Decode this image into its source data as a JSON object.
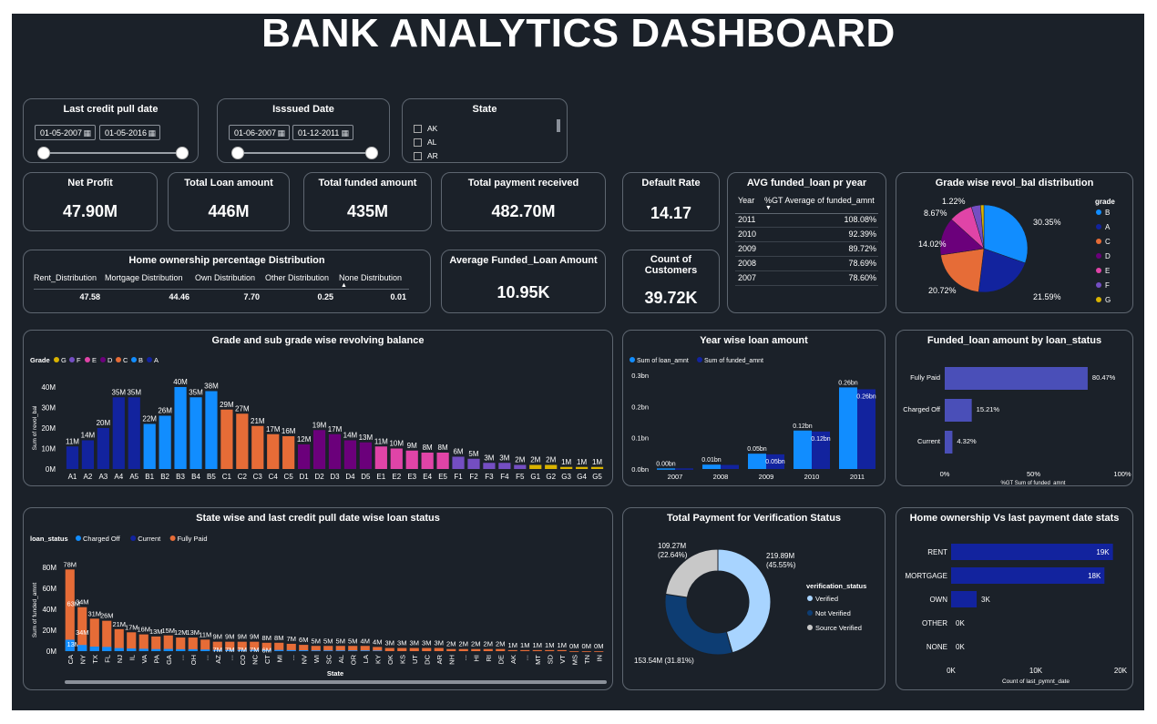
{
  "page": {
    "title": "BANK ANALYTICS DASHBOARD"
  },
  "filters": {
    "last_credit": {
      "title": "Last credit pull date",
      "from": "01-05-2007",
      "to": "01-05-2016"
    },
    "issued": {
      "title": "Isssued Date",
      "from": "01-06-2007",
      "to": "01-12-2011"
    },
    "state": {
      "title": "State",
      "options": [
        "AK",
        "AL",
        "AR"
      ]
    }
  },
  "kpis": {
    "net_profit": {
      "label": "Net Profit",
      "value": "47.90M"
    },
    "total_loan": {
      "label": "Total Loan amount",
      "value": "446M"
    },
    "total_funded": {
      "label": "Total funded amount",
      "value": "435M"
    },
    "total_payment": {
      "label": "Total payment received",
      "value": "482.70M"
    },
    "default_rate": {
      "label": "Default Rate",
      "value": "14.17"
    },
    "avg_funded": {
      "label": "Average Funded_Loan Amount",
      "value": "10.95K"
    },
    "customers": {
      "label_line1": "Count of",
      "label_line2": "Customers",
      "value": "39.72K"
    }
  },
  "home_ownership_pct": {
    "title": "Home ownership percentage Distribution",
    "columns": [
      "Rent_Distribution",
      "Mortgage Distribution",
      "Own Distribution",
      "Other Distribution",
      "None Distribution"
    ],
    "values": [
      "47.58",
      "44.46",
      "7.70",
      "0.25",
      "0.01"
    ]
  },
  "avg_funded_table": {
    "title": "AVG funded_loan pr year",
    "col_year": "Year",
    "col_value": "%GT Average of funded_amnt",
    "rows": [
      {
        "year": "2011",
        "value": "108.08%"
      },
      {
        "year": "2010",
        "value": "92.39%"
      },
      {
        "year": "2009",
        "value": "89.72%"
      },
      {
        "year": "2008",
        "value": "78.69%"
      },
      {
        "year": "2007",
        "value": "78.60%"
      }
    ]
  },
  "colors": {
    "A": "#12239e",
    "B": "#118dff",
    "C": "#e66c37",
    "D": "#6b007b",
    "E": "#e044a7",
    "F": "#744ec2",
    "G": "#d9b300",
    "bg": "#1b2129",
    "border": "#5e6670",
    "bar_blue": "#118dff",
    "bar_navy": "#12239e",
    "status_bar": "#4a4fb8",
    "verified": "#a8d4ff",
    "not_verified": "#0d3d73",
    "source_verified": "#c8c8c8"
  },
  "grade_pie": {
    "title": "Grade wise revol_bal distribution",
    "legend_title": "grade",
    "chart_data": {
      "type": "pie",
      "slices": [
        {
          "name": "B",
          "value": 30.35,
          "label": "30.35%"
        },
        {
          "name": "A",
          "value": 21.59,
          "label": "21.59%"
        },
        {
          "name": "C",
          "value": 20.72,
          "label": "20.72%"
        },
        {
          "name": "D",
          "value": 14.02,
          "label": "14.02%"
        },
        {
          "name": "E",
          "value": 8.67,
          "label": "8.67%"
        },
        {
          "name": "F",
          "value": 3.43,
          "label": ""
        },
        {
          "name": "G",
          "value": 1.22,
          "label": "1.22%"
        }
      ]
    }
  },
  "grade_bar": {
    "title": "Grade and sub grade wise revolving balance",
    "legend_title": "Grade",
    "legend": [
      "G",
      "F",
      "E",
      "D",
      "C",
      "B",
      "A"
    ],
    "chart_data": {
      "type": "bar",
      "ylabel": "Sum of revol_bal",
      "yticks": [
        "0M",
        "10M",
        "20M",
        "30M",
        "40M"
      ],
      "ylim": [
        0,
        40
      ],
      "categories": [
        "A1",
        "A2",
        "A3",
        "A4",
        "A5",
        "B1",
        "B2",
        "B3",
        "B4",
        "B5",
        "C1",
        "C2",
        "C3",
        "C4",
        "C5",
        "D1",
        "D2",
        "D3",
        "D4",
        "D5",
        "E1",
        "E2",
        "E3",
        "E4",
        "E5",
        "F1",
        "F2",
        "F3",
        "F4",
        "F5",
        "G1",
        "G2",
        "G3",
        "G4",
        "G5"
      ],
      "values": [
        11,
        14,
        20,
        35,
        35,
        22,
        26,
        40,
        35,
        38,
        29,
        27,
        21,
        17,
        16,
        12,
        19,
        17,
        14,
        13,
        11,
        10,
        9,
        8,
        8,
        6,
        5,
        3,
        3,
        2,
        2,
        2,
        1,
        1,
        1
      ],
      "labels": [
        "11M",
        "14M",
        "20M",
        "35M",
        "35M",
        "22M",
        "26M",
        "40M",
        "35M",
        "38M",
        "29M",
        "27M",
        "21M",
        "17M",
        "16M",
        "12M",
        "19M",
        "17M",
        "14M",
        "13M",
        "11M",
        "10M",
        "9M",
        "8M",
        "8M",
        "6M",
        "5M",
        "3M",
        "3M",
        "2M",
        "2M",
        "2M",
        "1M",
        "1M",
        "1M"
      ]
    }
  },
  "year_loan": {
    "title": "Year wise loan amount",
    "legend": [
      "Sum of loan_amnt",
      "Sum of funded_amnt"
    ],
    "chart_data": {
      "type": "bar",
      "yticks": [
        "0.0bn",
        "0.1bn",
        "0.2bn",
        "0.3bn"
      ],
      "ylim": [
        0,
        0.3
      ],
      "categories": [
        "2007",
        "2008",
        "2009",
        "2010",
        "2011"
      ],
      "series": [
        {
          "name": "Sum of loan_amnt",
          "values": [
            0.002,
            0.014,
            0.049,
            0.123,
            0.261
          ],
          "labels": [
            "0.00bn",
            "0.01bn",
            "0.05bn",
            "0.12bn",
            "0.26bn"
          ]
        },
        {
          "name": "Sum of funded_amnt",
          "values": [
            0.002,
            0.013,
            0.047,
            0.12,
            0.255
          ],
          "labels": [
            "",
            "",
            "0.05bn",
            "0.12bn",
            "0.26bn"
          ]
        }
      ]
    }
  },
  "loan_status": {
    "title": "Funded_loan amount by loan_status",
    "chart_data": {
      "type": "bar",
      "categories": [
        "Fully Paid",
        "Charged Off",
        "Current"
      ],
      "values": [
        80.47,
        15.21,
        4.32
      ],
      "labels": [
        "80.47%",
        "15.21%",
        "4.32%"
      ],
      "xticks": [
        "0%",
        "50%",
        "100%"
      ],
      "xlabel": "%GT Sum of funded_amnt",
      "xlim": [
        0,
        100
      ]
    }
  },
  "state_chart": {
    "title": "State wise and last credit pull date wise loan status",
    "legend_title": "loan_status",
    "legend": [
      "Charged Off",
      "Current",
      "Fully Paid"
    ],
    "chart_data": {
      "type": "bar",
      "ylabel": "Sum of funded_amnt",
      "xlabel": "State",
      "yticks": [
        "0M",
        "20M",
        "40M",
        "60M",
        "80M"
      ],
      "ylim": [
        0,
        80
      ],
      "categories": [
        "CA",
        "NY",
        "TX",
        "FL",
        "NJ",
        "IL",
        "VA",
        "PA",
        "GA",
        "...",
        "OH",
        "...",
        "AZ",
        "...",
        "CO",
        "NC",
        "CT",
        "MI",
        "...",
        "NV",
        "WI",
        "SC",
        "AL",
        "OR",
        "LA",
        "KY",
        "OK",
        "KS",
        "UT",
        "DC",
        "AR",
        "NH",
        "...",
        "HI",
        "RI",
        "DE",
        "AK",
        "...",
        "MT",
        "SD",
        "VT",
        "MS",
        "TN",
        "IN"
      ],
      "totals": [
        78,
        42,
        31,
        29,
        21,
        18,
        16,
        14,
        15,
        13,
        13,
        11,
        9,
        9,
        9,
        9,
        8,
        8,
        7,
        6,
        5,
        5,
        5,
        5,
        5,
        4,
        3,
        3,
        3,
        3,
        3,
        2,
        2,
        2,
        2,
        2,
        1,
        1,
        1,
        1,
        1,
        0,
        0,
        0
      ],
      "labels": [
        "78M",
        "34M",
        "31M",
        "26M",
        "21M",
        "17M",
        "16M",
        "13M",
        "15M",
        "12M",
        "13M",
        "11M",
        "9M",
        "9M",
        "9M",
        "9M",
        "8M",
        "8M",
        "7M",
        "6M",
        "5M",
        "5M",
        "5M",
        "5M",
        "4M",
        "4M",
        "3M",
        "3M",
        "3M",
        "3M",
        "3M",
        "2M",
        "2M",
        "2M",
        "2M",
        "2M",
        "1M",
        "1M",
        "1M",
        "1M",
        "1M",
        "0M",
        "0M",
        "0M"
      ],
      "extra_labels": {
        "0": [
          "63M",
          "13M"
        ],
        "1": [
          "34M"
        ],
        "12": [
          "7M"
        ],
        "13": [
          "7M"
        ],
        "14": [
          "7M"
        ],
        "15": [
          "7M"
        ],
        "16": [
          "6M"
        ]
      }
    }
  },
  "verification": {
    "title": "Total Payment for Verification Status",
    "legend_title": "verification_status",
    "chart_data": {
      "type": "pie",
      "slices": [
        {
          "name": "Verified",
          "value": 219.89,
          "label_line1": "219.89M",
          "label_line2": "(45.55%)"
        },
        {
          "name": "Not Verified",
          "value": 153.54,
          "label_line1": "153.54M (31.81%)",
          "label_line2": ""
        },
        {
          "name": "Source Verified",
          "value": 109.27,
          "label_line1": "109.27M",
          "label_line2": "(22.64%)"
        }
      ]
    }
  },
  "home_vs_payment": {
    "title": "Home ownership Vs last payment date stats",
    "chart_data": {
      "type": "bar",
      "categories": [
        "RENT",
        "MORTGAGE",
        "OWN",
        "OTHER",
        "NONE"
      ],
      "values": [
        19,
        18,
        3,
        0,
        0
      ],
      "labels": [
        "19K",
        "18K",
        "3K",
        "0K",
        "0K"
      ],
      "xticks": [
        "0K",
        "10K",
        "20K"
      ],
      "xlabel": "Count of last_pymnt_date",
      "xlim": [
        0,
        20
      ]
    }
  }
}
